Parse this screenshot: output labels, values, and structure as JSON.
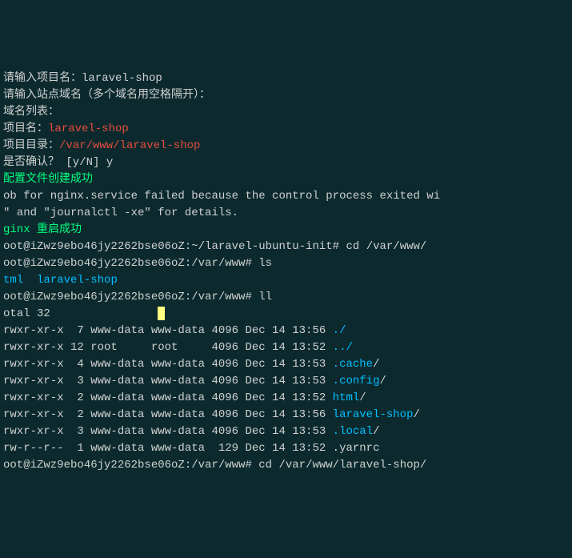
{
  "lines": {
    "l1_prefix": "请输入项目名：",
    "l1_value": "laravel-shop",
    "l2": "请输入站点域名（多个域名用空格隔开）：",
    "l3": "域名列表：",
    "l4_label": "项目名：",
    "l4_value": "laravel-shop",
    "l5_label": "项目目录：",
    "l5_value": "/var/www/laravel-shop",
    "l6_prompt": "是否确认？ [y/N] ",
    "l6_answer": "y",
    "l7": "配置文件创建成功",
    "l8": "ob for nginx.service failed because the control process exited wi",
    "l9": "\" and \"journalctl -xe\" for details.",
    "l10": "ginx 重启成功",
    "l11_prompt": "oot@iZwz9ebo46jy2262bse06oZ:~/laravel-ubuntu-init# ",
    "l11_cmd": "cd /var/www/",
    "l12_prompt": "oot@iZwz9ebo46jy2262bse06oZ:/var/www# ",
    "l12_cmd": "ls",
    "l13_a": "tml",
    "l13_b": "laravel-shop",
    "l14_prompt": "oot@iZwz9ebo46jy2262bse06oZ:/var/www# ",
    "l14_cmd": "ll",
    "l15": "otal 32",
    "ls_rows": [
      {
        "perm": "rwxr-xr-x",
        "links": " 7",
        "owner": "www-data",
        "group": "www-data",
        "size": "4096",
        "date": "Dec 14 13:56",
        "name": "./",
        "cls": "cyan"
      },
      {
        "perm": "rwxr-xr-x",
        "links": "12",
        "owner": "root    ",
        "group": "root    ",
        "size": "4096",
        "date": "Dec 14 13:52",
        "name": "../",
        "cls": "cyan"
      },
      {
        "perm": "rwxr-xr-x",
        "links": " 4",
        "owner": "www-data",
        "group": "www-data",
        "size": "4096",
        "date": "Dec 14 13:53",
        "name": ".cache",
        "cls": "cyan",
        "suffix": "/"
      },
      {
        "perm": "rwxr-xr-x",
        "links": " 3",
        "owner": "www-data",
        "group": "www-data",
        "size": "4096",
        "date": "Dec 14 13:53",
        "name": ".config",
        "cls": "cyan",
        "suffix": "/"
      },
      {
        "perm": "rwxr-xr-x",
        "links": " 2",
        "owner": "www-data",
        "group": "www-data",
        "size": "4096",
        "date": "Dec 14 13:52",
        "name": "html",
        "cls": "cyan",
        "suffix": "/"
      },
      {
        "perm": "rwxr-xr-x",
        "links": " 2",
        "owner": "www-data",
        "group": "www-data",
        "size": "4096",
        "date": "Dec 14 13:56",
        "name": "laravel-shop",
        "cls": "cyan",
        "suffix": "/"
      },
      {
        "perm": "rwxr-xr-x",
        "links": " 3",
        "owner": "www-data",
        "group": "www-data",
        "size": "4096",
        "date": "Dec 14 13:53",
        "name": ".local",
        "cls": "cyan",
        "suffix": "/"
      },
      {
        "perm": "rw-r--r--",
        "links": " 1",
        "owner": "www-data",
        "group": "www-data",
        "size": " 129",
        "date": "Dec 14 13:52",
        "name": ".yarnrc",
        "cls": "white",
        "suffix": ""
      }
    ],
    "last_prompt": "oot@iZwz9ebo46jy2262bse06oZ:/var/www# ",
    "last_cmd": "cd /var/www/laravel-shop/"
  }
}
